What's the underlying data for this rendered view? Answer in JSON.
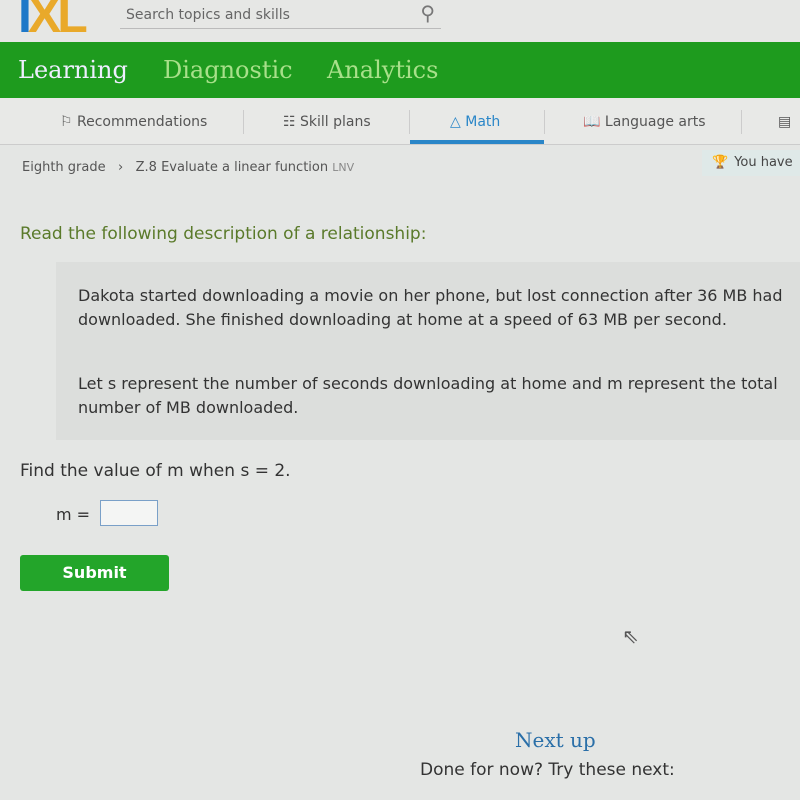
{
  "header": {
    "logo": "IXL",
    "search_placeholder": "Search topics and skills"
  },
  "nav": [
    "Learning",
    "Diagnostic",
    "Analytics"
  ],
  "subnav": [
    "Recommendations",
    "Skill plans",
    "Math",
    "Language arts"
  ],
  "breadcrumb": {
    "grade": "Eighth grade",
    "skill": "Z.8 Evaluate a linear function",
    "code": "LNV"
  },
  "award": "You have",
  "question": {
    "prompt": "Read the following description of a relationship:",
    "p1": "Dakota started downloading a movie on her phone, but lost connection after 36 MB had downloaded. She finished downloading at home at a speed of 63 MB per second.",
    "p2": "Let s represent the number of seconds downloading at home and m represent the total number of MB downloaded.",
    "ask": "Find the value of m when s = 2.",
    "label": "m =",
    "answer": ""
  },
  "submit": "Submit",
  "next_up": "Next up",
  "done": "Done for now? Try these next:"
}
